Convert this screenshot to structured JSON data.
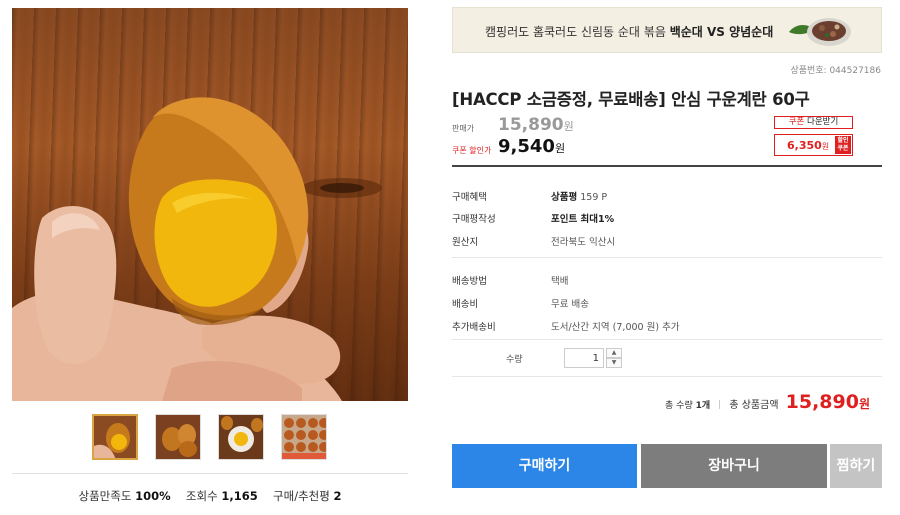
{
  "gallery": {
    "main_image": "braised-egg-photo",
    "thumbnails": [
      "egg-hand-thumb",
      "eggs-plate-thumb",
      "egg-cut-thumb",
      "egg-tray-thumb"
    ],
    "active_index": 0
  },
  "stats": {
    "satisfaction_label": "상품만족도",
    "satisfaction_value": "100%",
    "views_label": "조회수",
    "views_value": "1,165",
    "reviews_label": "구매/추천평",
    "reviews_value": "2"
  },
  "banner": {
    "text_prefix": "캠핑러도 홈쿡러도 신림동 순대 볶음 ",
    "text_bold": "백순대 VS 양념순대"
  },
  "product": {
    "number_label": "상품번호: 044527186",
    "title": "[HACCP 소금증정, 무료배송] 안심 구운계란 60구",
    "price_label": "판매가",
    "price": "15,890",
    "price_unit": "원",
    "sale_label": "쿠폰 할인가",
    "sale_price": "9,540",
    "sale_unit": "원"
  },
  "coupon": {
    "download_prefix": "쿠폰",
    "download_suffix": " 다운받기",
    "amount": "6,350",
    "amount_unit": "원",
    "tag": "할인 쿠폰"
  },
  "info": {
    "benefit_label": "구매혜택",
    "benefit_bold": "상품평",
    "benefit_rest": " 159 P",
    "review_label": "구매평작성",
    "review_value": "포인트 최대1%",
    "origin_label": "원산지",
    "origin_value": "전라북도 익산시",
    "ship_method_label": "배송방법",
    "ship_method_value": "택배",
    "ship_fee_label": "배송비",
    "ship_fee_value": "무료 배송",
    "extra_fee_label": "추가배송비",
    "extra_fee_value": "도서/산간 지역 (7,000 원) 추가"
  },
  "quantity": {
    "label": "수량",
    "value": "1"
  },
  "total": {
    "qty_label": "총 수량",
    "qty_value": "1개",
    "amount_label": "총 상품금액",
    "amount_value": "15,890",
    "amount_unit": "원"
  },
  "buttons": {
    "buy": "구매하기",
    "cart": "장바구니",
    "wish": "찜하기"
  },
  "colors": {
    "accent_red": "#e02020",
    "buy_blue": "#2b86e8",
    "cart_gray": "#7d7d7d"
  }
}
